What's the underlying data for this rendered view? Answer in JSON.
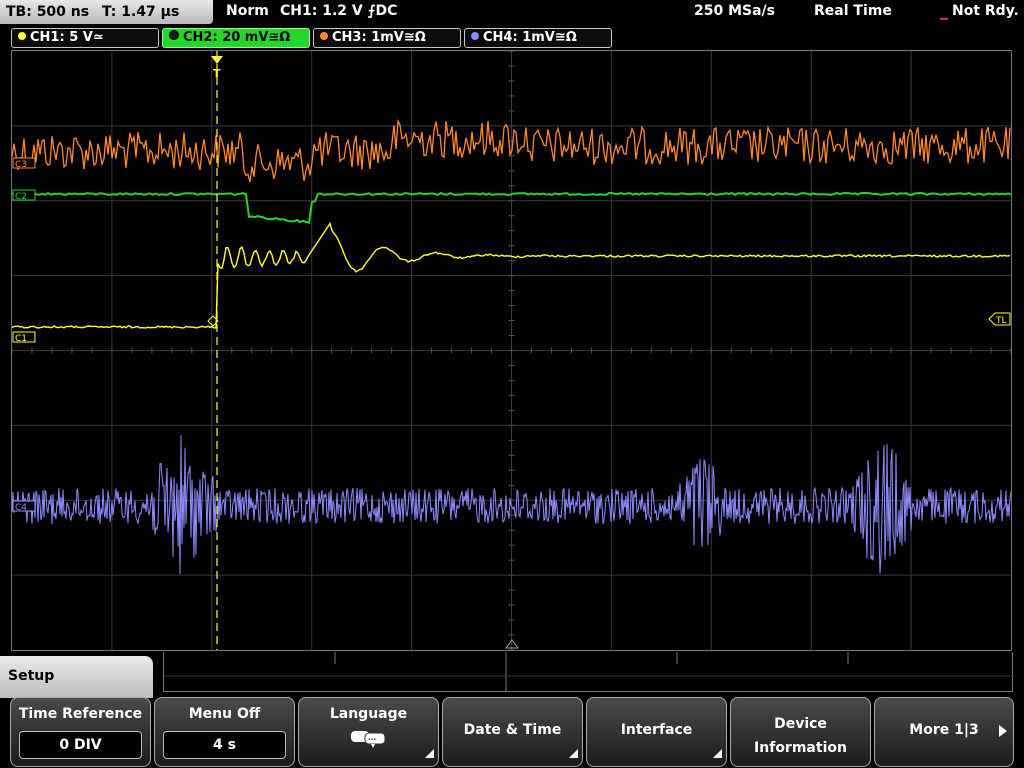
{
  "status": {
    "timebase": "TB: 500 ns",
    "trigger_time": "T: 1.47 µs",
    "mode": "Norm",
    "trigger": "CH1: 1.2 V ⨍DC",
    "sample_rate": "250 MSa/s",
    "acq_mode": "Real Time",
    "state": "Not Rdy."
  },
  "channels": [
    {
      "label": "CH1: 5 V≃",
      "color": "#ffff33"
    },
    {
      "label": "CH2: 20 mV≅Ω",
      "color": "#22d62a"
    },
    {
      "label": "CH3: 1mV≅Ω",
      "color": "#ff8a2a"
    },
    {
      "label": "CH4: 1mV≅Ω",
      "color": "#8c8cff"
    }
  ],
  "markers": {
    "c3": "C3",
    "c2": "C2",
    "c1": "C1",
    "c4": "C4",
    "trigger_level": "TL",
    "trigger_pos": "T"
  },
  "menu": {
    "title": "Setup",
    "time_reference": {
      "label": "Time Reference",
      "value": "0 DIV"
    },
    "menu_off": {
      "label": "Menu Off",
      "value": "4 s"
    },
    "language": {
      "label": "Language",
      "icon": "speech-bubbles-icon"
    },
    "date_time": {
      "label": "Date & Time"
    },
    "interface": {
      "label": "Interface"
    },
    "device_info": {
      "line1": "Device",
      "line2": "Information"
    },
    "more": {
      "label": "More 1|3"
    }
  }
}
